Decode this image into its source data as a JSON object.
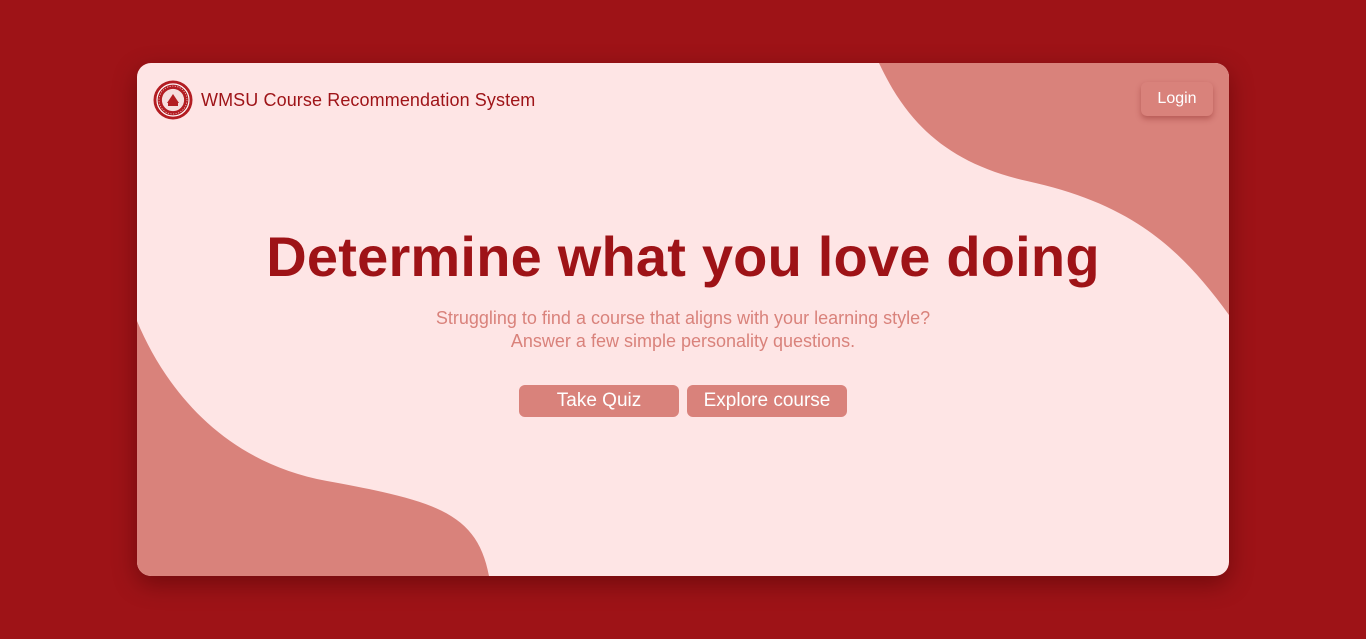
{
  "header": {
    "logo_icon": "wmsu-seal-icon",
    "title": "WMSU Course Recommendation System",
    "login_label": "Login"
  },
  "hero": {
    "headline": "Determine what you love doing",
    "subline_1": "Struggling to find a course that aligns with your learning style?",
    "subline_2": "Answer a few simple personality questions."
  },
  "actions": {
    "take_quiz_label": "Take Quiz",
    "explore_label": "Explore course"
  },
  "colors": {
    "page_background": "#9e1317",
    "card_background": "#fee5e5",
    "accent": "#d9827b",
    "primary_text": "#9e1317"
  }
}
